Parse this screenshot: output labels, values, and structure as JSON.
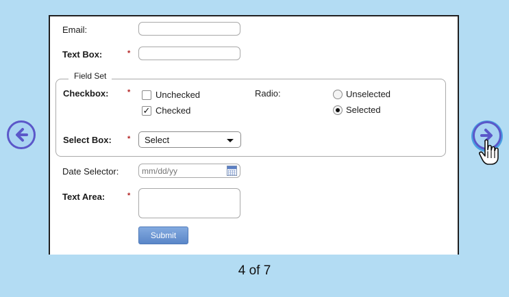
{
  "form": {
    "email_label": "Email:",
    "textbox_label": "Text Box:",
    "required_marker": "*",
    "fieldset_legend": "Field Set",
    "checkbox_label": "Checkbox:",
    "checkbox_unchecked_label": "Unchecked",
    "checkbox_checked_label": "Checked",
    "checkbox_checked_state": true,
    "radio_label": "Radio:",
    "radio_unselected_label": "Unselected",
    "radio_selected_label": "Selected",
    "selectbox_label": "Select Box:",
    "selectbox_value": "Select",
    "date_label": "Date Selector:",
    "date_placeholder": "mm/dd/yy",
    "textarea_label": "Text Area:",
    "submit_label": "Submit"
  },
  "pager": {
    "indicator": "4 of 7"
  },
  "colors": {
    "background": "#b3dcf3",
    "nav_ring": "#5b57c9",
    "submit": "#6b95d2",
    "required": "#b22222"
  },
  "icons": {
    "prev": "arrow-left-circle-icon",
    "next": "arrow-right-circle-icon",
    "cursor": "hand-pointer-icon",
    "calendar": "calendar-icon"
  }
}
